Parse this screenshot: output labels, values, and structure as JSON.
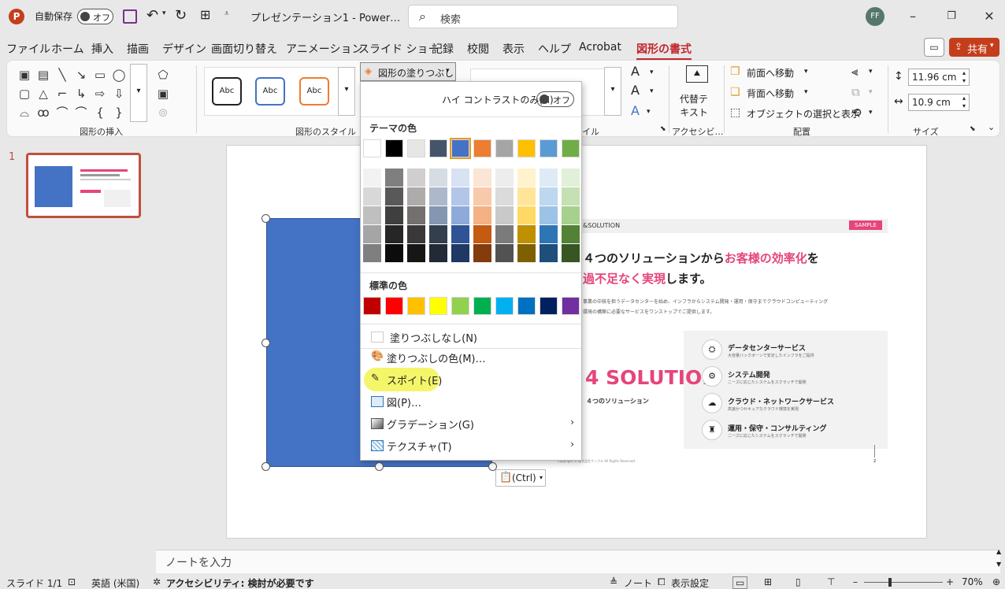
{
  "titlebar": {
    "autosave_label": "自動保存",
    "autosave_state": "オフ",
    "doc_title": "プレゼンテーション1  -  Power…",
    "search_placeholder": "検索",
    "avatar_initials": "FF"
  },
  "menu": [
    "ファイル",
    "ホーム",
    "挿入",
    "描画",
    "デザイン",
    "画面切り替え",
    "アニメーション",
    "スライド ショー",
    "記録",
    "校閲",
    "表示",
    "ヘルプ",
    "Acrobat",
    "図形の書式"
  ],
  "share_label": "共有",
  "ribbon": {
    "group_insert_shapes": "図形の挿入",
    "group_shape_styles": "図形のスタイル",
    "style_sample": "Abc",
    "fill_button": "図形の塗りつぶし",
    "group_wordart_partial": "イル",
    "group_accessibility": "アクセシビ…",
    "alt_text": "代替テ\nキスト",
    "bring_forward": "前面へ移動",
    "send_backward": "背面へ移動",
    "selection_pane": "オブジェクトの選択と表示",
    "group_arrange": "配置",
    "height_value": "11.96 cm",
    "width_value": "10.9 cm",
    "group_size": "サイズ"
  },
  "dropdown": {
    "high_contrast_label": "ハイ コントラストのみ(H)",
    "high_contrast_state": "オフ",
    "theme_colors_label": "テーマの色",
    "standard_colors_label": "標準の色",
    "no_fill": "塗りつぶしなし(N)",
    "more_colors": "塗りつぶしの色(M)…",
    "eyedropper": "スポイト(E)",
    "picture": "図(P)…",
    "gradient": "グラデーション(G)",
    "texture": "テクスチャ(T)",
    "theme_colors": [
      "#ffffff",
      "#000000",
      "#e7e6e6",
      "#44546a",
      "#4472c4",
      "#ed7d31",
      "#a5a5a5",
      "#ffc000",
      "#5b9bd5",
      "#70ad47"
    ],
    "theme_shades": [
      [
        "#f2f2f2",
        "#7f7f7f",
        "#d0cece",
        "#d6dce4",
        "#d9e2f3",
        "#fbe5d5",
        "#ededed",
        "#fff2cc",
        "#deebf6",
        "#e2efd9"
      ],
      [
        "#d8d8d8",
        "#595959",
        "#aeabab",
        "#adb9ca",
        "#b4c6e7",
        "#f7caac",
        "#dbdbdb",
        "#fee599",
        "#bdd7ee",
        "#c5e0b3"
      ],
      [
        "#bfbfbf",
        "#3f3f3f",
        "#757070",
        "#8496b0",
        "#8eaadb",
        "#f4b183",
        "#c9c9c9",
        "#ffd965",
        "#9cc3e5",
        "#a8d08d"
      ],
      [
        "#a5a5a5",
        "#262626",
        "#3a3838",
        "#323f4f",
        "#2f5496",
        "#c55a11",
        "#7b7b7b",
        "#bf9000",
        "#2e75b5",
        "#538135"
      ],
      [
        "#7f7f7f",
        "#0c0c0c",
        "#171616",
        "#222a35",
        "#1f3864",
        "#833c0b",
        "#525252",
        "#7f6000",
        "#1e4e79",
        "#375623"
      ]
    ],
    "standard_colors": [
      "#c00000",
      "#ff0000",
      "#ffc000",
      "#ffff00",
      "#92d050",
      "#00b050",
      "#00b0f0",
      "#0070c0",
      "#002060",
      "#7030a0"
    ]
  },
  "slide_content": {
    "section_tag": "&SOLUTION",
    "sample_badge": "SAMPLE",
    "heading_line1_a": "４つのソリューションから",
    "heading_line1_b": "お客様の効率化",
    "heading_line1_c": "を",
    "heading_line2_a": "過不足なく実現",
    "heading_line2_b": "します。",
    "body_line1": "事業の中核を担うデータセンターを始め、インフラからシステム開発・運用・保守までクラウドコンピューティング",
    "body_line2": "環境の構築に必要なサービスをワンストップでご提供します。",
    "big_label": "4 SOLUTION",
    "big_sub": "４つのソリューション",
    "services": [
      {
        "title": "データセンターサービス",
        "desc": "大容量バックボーンで安定したインフラをご提供"
      },
      {
        "title": "システム開発",
        "desc": "ニーズに応じたシステムをスクラッチで開発"
      },
      {
        "title": "クラウド・ネットワークサービス",
        "desc": "高速かつセキュアなクラウド環境を実現"
      },
      {
        "title": "運用・保守・コンサルティング",
        "desc": "ニーズに応じたシステムをスクラッチで開発"
      }
    ],
    "footer": "Copyright © 株式会社サンプル All Rights Reserved.",
    "page_num": "2"
  },
  "paste_options": "(Ctrl)",
  "thumbnail_number": "1",
  "notes_placeholder": "ノートを入力",
  "status": {
    "slide": "スライド 1/1",
    "language": "英語 (米国)",
    "accessibility": "アクセシビリティ: 検討が必要です",
    "notes": "ノート",
    "display_settings": "表示設定",
    "zoom": "70%"
  },
  "colors": {
    "accent": "#c1272d",
    "shape_fill": "#4472c4",
    "pink": "#e5457b",
    "highlight": "#f5f56a"
  }
}
